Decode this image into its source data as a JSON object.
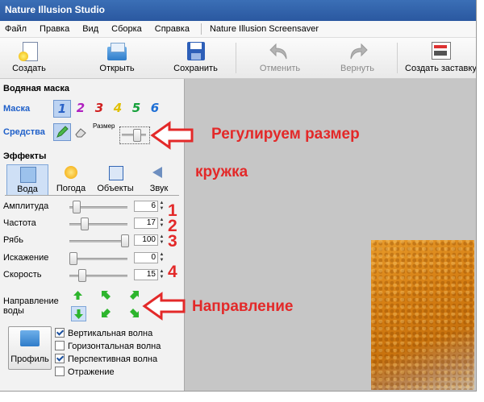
{
  "window": {
    "title": "Nature Illusion Studio"
  },
  "menu": {
    "items": [
      "Файл",
      "Правка",
      "Вид",
      "Сборка",
      "Справка"
    ],
    "extra": "Nature Illusion Screensaver"
  },
  "toolbar": {
    "create": "Создать",
    "open": "Открыть",
    "save": "Сохранить",
    "undo": "Отменить",
    "redo": "Вернуть",
    "build": "Создать заставку"
  },
  "watermask": {
    "section": "Водяная маска",
    "mask_label": "Маска",
    "tools_label": "Средства",
    "size_label": "Размер",
    "mask_numbers": [
      "1",
      "2",
      "3",
      "4",
      "5",
      "6"
    ],
    "mask_colors": [
      "#2a62c7",
      "#b020c0",
      "#d01f1f",
      "#e0c000",
      "#15a03a",
      "#1e6fd6"
    ]
  },
  "effects": {
    "section": "Эффекты",
    "tabs": [
      "Вода",
      "Погода",
      "Объекты",
      "Звук"
    ],
    "sliders": [
      {
        "label": "Амплитуда",
        "value": "6"
      },
      {
        "label": "Частота",
        "value": "17"
      },
      {
        "label": "Рябь",
        "value": "100"
      },
      {
        "label": "Искажение",
        "value": "0"
      },
      {
        "label": "Скорость",
        "value": "15"
      }
    ],
    "direction_label_1": "Направление",
    "direction_label_2": "воды",
    "profile": "Профиль",
    "checkboxes": [
      {
        "label": "Вертикальная волна",
        "checked": true
      },
      {
        "label": "Горизонтальная волна",
        "checked": false
      },
      {
        "label": "Перспективная волна",
        "checked": true
      },
      {
        "label": "Отражение",
        "checked": false
      }
    ]
  },
  "annotations": {
    "size_note": "Регулируем размер",
    "size_note2": "кружка",
    "direction_note": "Направление",
    "nums": [
      "1",
      "2",
      "3",
      "4"
    ]
  },
  "colors": {
    "accent_red": "#e32929",
    "title_blue": "#2a58a0",
    "arrow_green": "#2db52d"
  }
}
